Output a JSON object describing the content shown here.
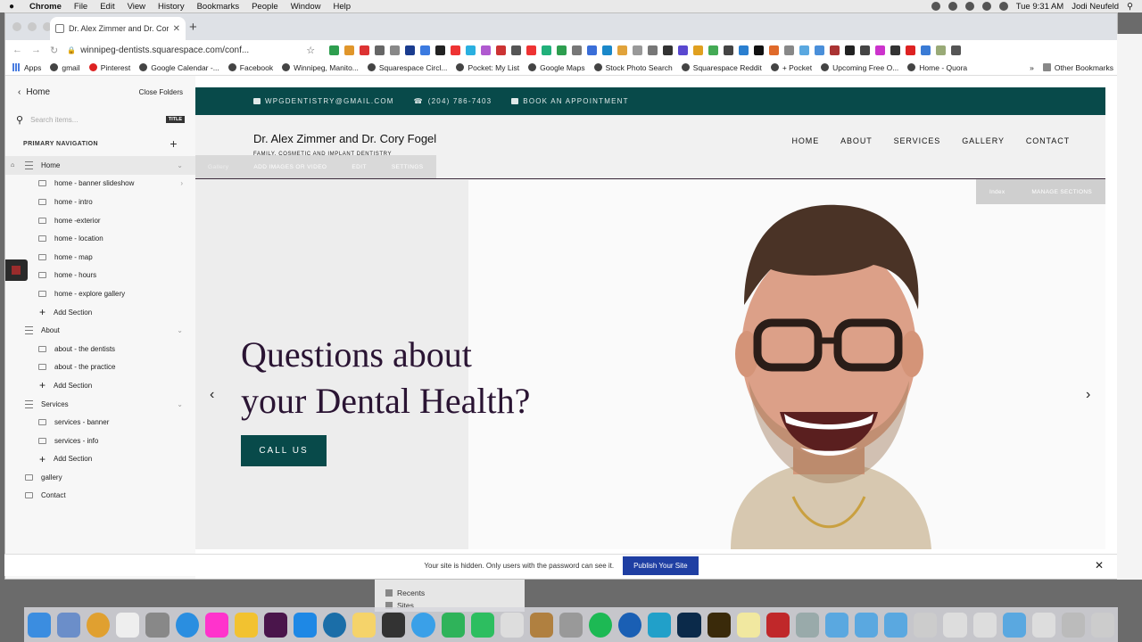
{
  "menubar": {
    "app": "Chrome",
    "items": [
      "File",
      "Edit",
      "View",
      "History",
      "Bookmarks",
      "People",
      "Window",
      "Help"
    ],
    "clock": "Tue 9:31 AM",
    "user": "Jodi Neufeld"
  },
  "browser": {
    "tab_title": "Dr. Alex Zimmer and Dr. Cory F",
    "url": "winnipeg-dentists.squarespace.com/conf...",
    "bookmarks": [
      "Apps",
      "gmail",
      "Pinterest",
      "Google Calendar -...",
      "Facebook",
      "Winnipeg, Manito...",
      "Squarespace Circl...",
      "Pocket: My List",
      "Google Maps",
      "Stock Photo Search",
      "Squarespace Reddit",
      "+ Pocket",
      "Upcoming Free O...",
      "Home - Quora"
    ],
    "bookmarks_more": "»",
    "other_bookmarks": "Other Bookmarks"
  },
  "panel": {
    "back_label": "Home",
    "close_folders": "Close Folders",
    "search_placeholder": "Search items...",
    "title_badge": "TITLE",
    "primary_nav": "PRIMARY NAVIGATION",
    "tree": [
      {
        "label": "Home",
        "level": 0,
        "type": "folder"
      },
      {
        "label": "home - banner slideshow",
        "level": 1,
        "type": "page"
      },
      {
        "label": "home - intro",
        "level": 1,
        "type": "page"
      },
      {
        "label": "home -exterior",
        "level": 1,
        "type": "page"
      },
      {
        "label": "home - location",
        "level": 1,
        "type": "page"
      },
      {
        "label": "home - map",
        "level": 1,
        "type": "page"
      },
      {
        "label": "home - hours",
        "level": 1,
        "type": "page"
      },
      {
        "label": "home - explore gallery",
        "level": 1,
        "type": "page"
      },
      {
        "label": "Add Section",
        "level": 1,
        "type": "add"
      },
      {
        "label": "About",
        "level": 0,
        "type": "folder"
      },
      {
        "label": "about - the dentists",
        "level": 1,
        "type": "page"
      },
      {
        "label": "about - the practice",
        "level": 1,
        "type": "page"
      },
      {
        "label": "Add Section",
        "level": 1,
        "type": "add"
      },
      {
        "label": "Services",
        "level": 0,
        "type": "folder"
      },
      {
        "label": "services - banner",
        "level": 1,
        "type": "page"
      },
      {
        "label": "services - info",
        "level": 1,
        "type": "page"
      },
      {
        "label": "Add Section",
        "level": 1,
        "type": "add"
      },
      {
        "label": "gallery",
        "level": 0,
        "type": "page"
      },
      {
        "label": "Contact",
        "level": 0,
        "type": "page"
      }
    ]
  },
  "site": {
    "email": "WPGDENTISTRY@GMAIL.COM",
    "phone": "(204) 786-7403",
    "book": "BOOK AN APPOINTMENT",
    "brand": "Dr. Alex Zimmer and Dr. Cory Fogel",
    "tagline": "FAMILY, COSMETIC AND IMPLANT DENTISTRY",
    "gallery_bar": [
      "Gallery",
      "ADD IMAGES OR VIDEO",
      "EDIT",
      "SETTINGS"
    ],
    "nav": [
      "HOME",
      "ABOUT",
      "SERVICES",
      "GALLERY",
      "CONTACT"
    ],
    "manage": [
      "Index",
      "MANAGE SECTIONS"
    ],
    "headline_1": "Questions about",
    "headline_2": "your Dental Health?",
    "cta": "CALL US"
  },
  "notice": {
    "text": "Your site is hidden. Only users with the password can see it.",
    "publish": "Publish Your Site"
  },
  "desktop": {
    "finder_items": [
      "Recents",
      "Sites"
    ]
  },
  "colors": {
    "accent": "#084a4a",
    "headline": "#2a1433",
    "publish": "#1f3fa3"
  }
}
